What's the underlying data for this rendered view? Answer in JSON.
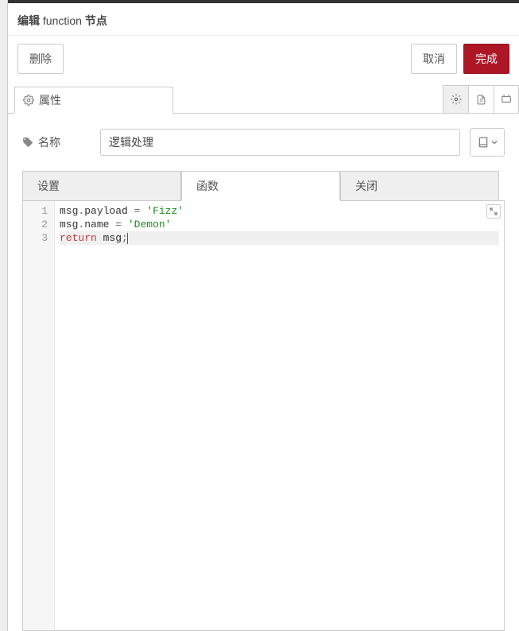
{
  "header": {
    "prefix": "编辑 ",
    "type": "function",
    "suffix": " 节点"
  },
  "actions": {
    "delete": "删除",
    "cancel": "取消",
    "done": "完成"
  },
  "main_tab": {
    "label": "属性"
  },
  "form": {
    "name_label": "名称",
    "name_value": "逻辑处理"
  },
  "sub_tabs": {
    "setup": "设置",
    "func": "函数",
    "close": "关闭"
  },
  "editor": {
    "lines": [
      {
        "num": "1"
      },
      {
        "num": "2"
      },
      {
        "num": "3"
      }
    ]
  },
  "chart_data": {
    "type": "code",
    "language": "javascript",
    "code": "msg.payload = 'Fizz'\nmsg.name = 'Demon'\nreturn msg;"
  }
}
